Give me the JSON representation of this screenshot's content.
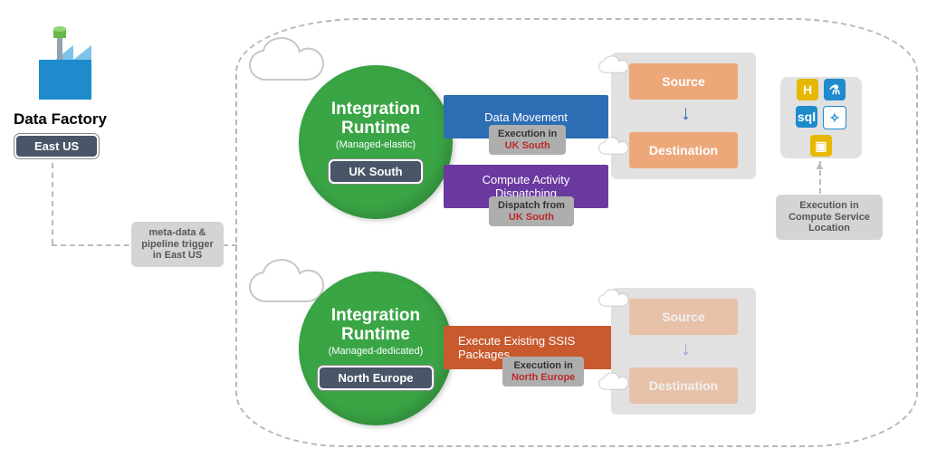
{
  "adf": {
    "title": "Data Factory",
    "region": "East US"
  },
  "meta_note": "meta-data & pipeline trigger in East US",
  "ir1": {
    "title1": "Integration",
    "title2": "Runtime",
    "sub": "(Managed-elastic)",
    "region": "UK South"
  },
  "ir2": {
    "title1": "Integration",
    "title2": "Runtime",
    "sub": "(Managed-dedicated)",
    "region": "North Europe"
  },
  "act": {
    "data_move": "Data Movement",
    "compute1": "Compute Activity",
    "compute2": "Dispatching",
    "ssis": "Execute Existing SSIS Packages"
  },
  "sub": {
    "exec_prefix": "Execution in",
    "dispatch_prefix": "Dispatch from",
    "loc_uk": "UK South",
    "loc_ne": "North Europe"
  },
  "sd": {
    "source": "Source",
    "dest": "Destination"
  },
  "svc_note": "Execution in Compute Service Location",
  "svc_icons": [
    "hadoop",
    "beaker",
    "sql",
    "spark",
    "dw"
  ]
}
